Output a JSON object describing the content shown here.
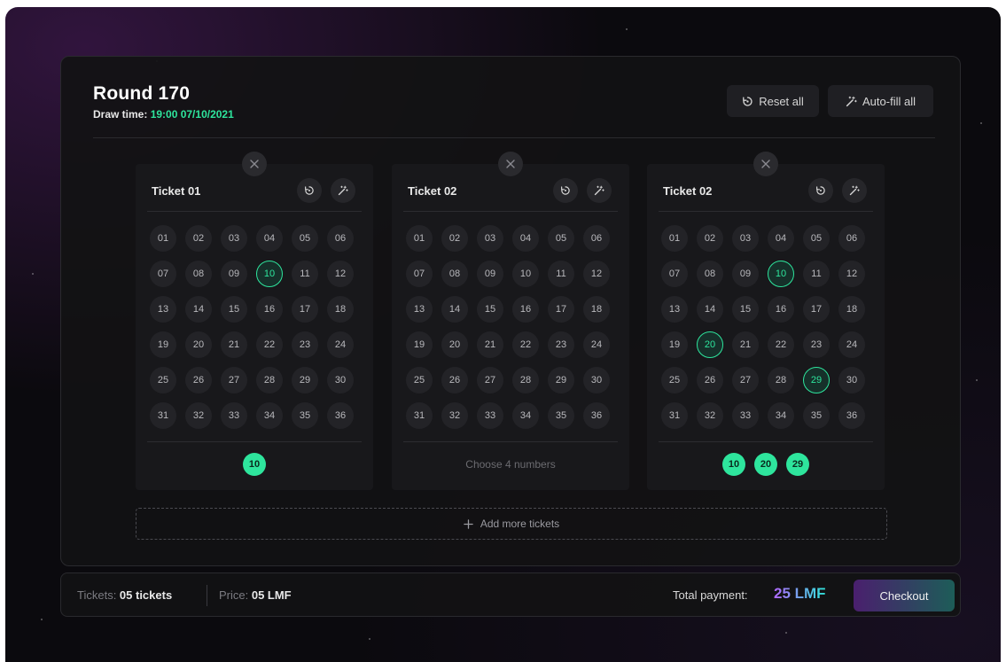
{
  "header": {
    "round_title": "Round 170",
    "draw_time_label": "Draw time: ",
    "draw_time_value": "19:00 07/10/2021",
    "reset_all_label": "Reset all",
    "auto_fill_all_label": "Auto-fill all"
  },
  "numbers": [
    "01",
    "02",
    "03",
    "04",
    "05",
    "06",
    "07",
    "08",
    "09",
    "10",
    "11",
    "12",
    "13",
    "14",
    "15",
    "16",
    "17",
    "18",
    "19",
    "20",
    "21",
    "22",
    "23",
    "24",
    "25",
    "26",
    "27",
    "28",
    "29",
    "30",
    "31",
    "32",
    "33",
    "34",
    "35",
    "36"
  ],
  "tickets": [
    {
      "title": "Ticket 01",
      "selected": [
        "10"
      ],
      "empty_hint": ""
    },
    {
      "title": "Ticket 02",
      "selected": [],
      "empty_hint": "Choose 4 numbers"
    },
    {
      "title": "Ticket 02",
      "selected": [
        "10",
        "20",
        "29"
      ],
      "empty_hint": ""
    }
  ],
  "add_more_label": "Add more tickets",
  "footer": {
    "tickets_label": "Tickets: ",
    "tickets_value": "05 tickets",
    "price_label": "Price: ",
    "price_value": "05 LMF",
    "total_label": "Total payment:",
    "total_value": "25 LMF",
    "checkout_label": "Checkout"
  },
  "colors": {
    "accent_green": "#2ee59d",
    "background": "#0b0a0e",
    "card": "#18181b"
  },
  "icons": [
    "reset-icon",
    "magic-wand-icon",
    "close-icon",
    "plus-icon"
  ]
}
